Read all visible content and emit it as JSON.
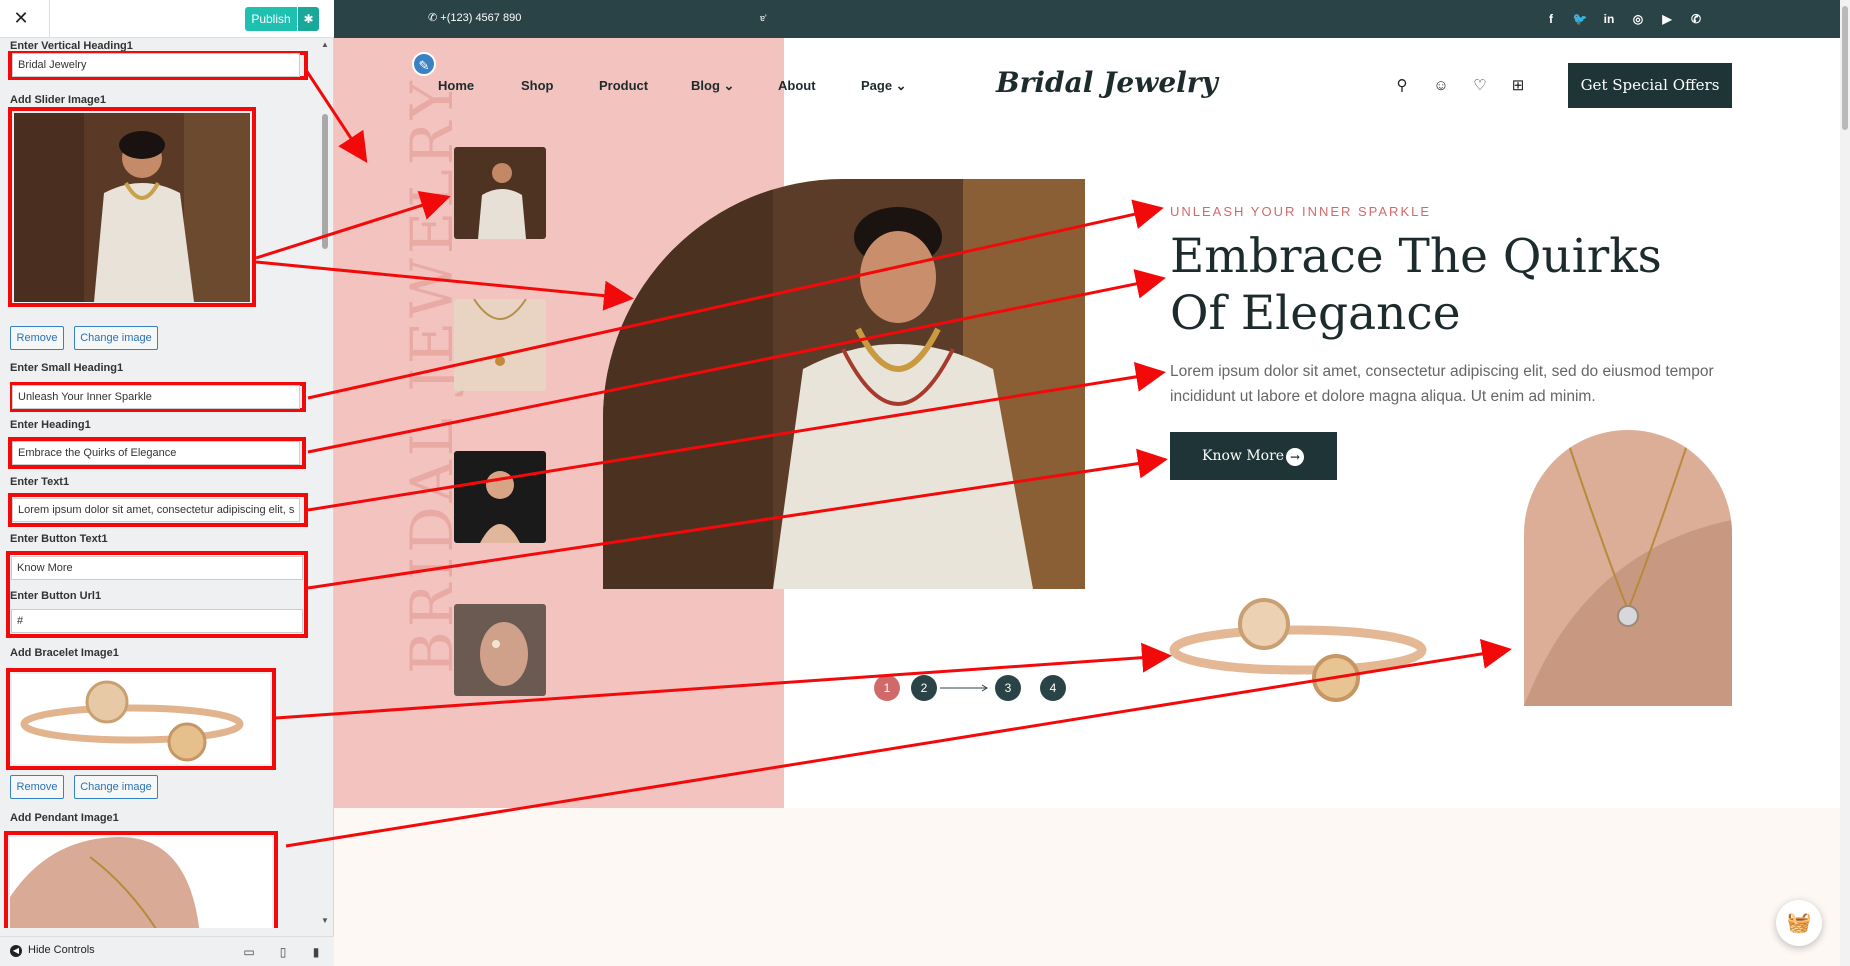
{
  "panel": {
    "close_glyph": "✕",
    "publish_label": "Publish",
    "gear_glyph": "✱",
    "fields": {
      "vertical_heading_label": "Enter Vertical Heading1",
      "vertical_heading_value": "Bridal Jewelry",
      "slider_image_label": "Add Slider Image1",
      "remove_label": "Remove",
      "change_image_label": "Change image",
      "small_heading_label": "Enter Small Heading1",
      "small_heading_value": "Unleash Your Inner Sparkle",
      "heading_label": "Enter Heading1",
      "heading_value": "Embrace the Quirks of Elegance",
      "text_label": "Enter Text1",
      "text_value": "Lorem ipsum dolor sit amet, consectetur adipiscing elit, s",
      "button_text_label": "Enter Button Text1",
      "button_text_value": "Know More",
      "button_url_label": "Enter Button Url1",
      "button_url_value": "#",
      "bracelet_label": "Add Bracelet Image1",
      "pendant_label": "Add Pendant Image1"
    },
    "footer": {
      "hide_controls": "Hide Controls"
    }
  },
  "site": {
    "phone": "+(123) 4567 890",
    "tiny_mark": "ɐ'",
    "social": [
      "f",
      "t",
      "in",
      "ig",
      "yt",
      "wa"
    ],
    "nav": [
      {
        "label": "Home"
      },
      {
        "label": "Shop"
      },
      {
        "label": "Product"
      },
      {
        "label": "Blog ⌄"
      },
      {
        "label": "About"
      },
      {
        "label": "Page ⌄"
      }
    ],
    "logo": "Bridal Jewelry",
    "offers_button": "Get Special Offers",
    "vertical_heading": "BRIDAL JEWELRY",
    "small_heading": "UNLEASH YOUR INNER SPARKLE",
    "heading": "Embrace The Quirks Of Elegance",
    "text": "Lorem ipsum dolor sit amet, consectetur adipiscing elit, sed do eiusmod tempor incididunt ut labore et dolore magna aliqua. Ut enim ad minim.",
    "button": "Know More",
    "slides": [
      "1",
      "2",
      "3",
      "4"
    ]
  },
  "colors": {
    "topbar": "#2a4346",
    "pink_column": "#f2c3bf",
    "accent_red": "#f20a0a",
    "publish": "#1ec0b0",
    "dark_button": "#1f3436",
    "active_dot": "#d06a6a"
  },
  "icons": {
    "search": "search-icon",
    "user": "user-icon",
    "wishlist": "heart-icon",
    "cart": "cart-icon",
    "edit": "pencil-icon"
  }
}
